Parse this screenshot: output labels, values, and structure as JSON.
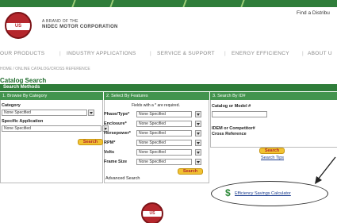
{
  "header": {
    "logo_text": "US MOTORS",
    "brand_small": "A BRAND OF THE",
    "brand_big": "NIDEC MOTOR CORPORATION",
    "find_text": "Find a Distribu"
  },
  "nav": {
    "items": [
      "OUR PRODUCTS",
      "INDUSTRY APPLICATIONS",
      "SERVICE & SUPPORT",
      "ENERGY EFFICIENCY",
      "ABOUT U"
    ]
  },
  "breadcrumb": "HOME / ONLINE CATALOG/CROSS REFERENCE",
  "page_title": "Catalog Search",
  "search_methods_label": "Search Methods",
  "columns": {
    "browse": {
      "header": "1. Browse By Category",
      "category_label": "Category",
      "category_value": "None Specified",
      "application_label": "Specific Application",
      "application_value": "None Specified",
      "search_label": "Search"
    },
    "features": {
      "header": "2. Select By Features",
      "required_note": "Fields with a * are required.",
      "fields": [
        {
          "label": "Phase/Type*",
          "value": "None Specified"
        },
        {
          "label": "Enclosure*",
          "value": "None Specified"
        },
        {
          "label": "Horsepower*",
          "value": "None Specified"
        },
        {
          "label": "RPM*",
          "value": "None Specified"
        },
        {
          "label": "Volts",
          "value": "None Specified"
        },
        {
          "label": "Frame Size",
          "value": "None Specified"
        }
      ],
      "search_label": "Search",
      "advanced_label": "Advanced Search"
    },
    "id": {
      "header": "3. Search By ID#",
      "catalog_label": "Catalog or Model #",
      "competitor_label": "IDEM or Competitor#",
      "cross_label": "Cross Reference",
      "search_label": "Search",
      "tips_label": "Search Tips"
    }
  },
  "callout": {
    "icon": "dollar-icon",
    "link_text": "Efficiency Savings Calculator"
  },
  "footer_logo_text": "US MOTORS",
  "colors": {
    "green": "#2f7d3a",
    "light_green": "#43944e",
    "red": "#b5272d",
    "button": "#f1c232"
  }
}
